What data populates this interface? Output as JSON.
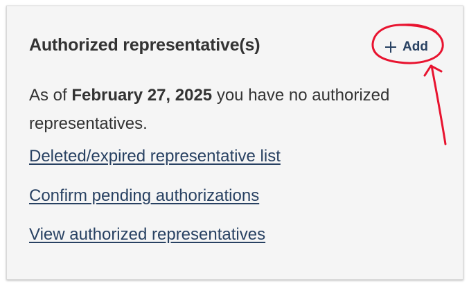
{
  "card": {
    "title": "Authorized representative(s)",
    "add_button": {
      "icon": "plus-icon",
      "label": "Add"
    },
    "status": {
      "prefix": "As of ",
      "date": "February 27, 2025",
      "suffix": " you have no authorized representatives."
    },
    "links": [
      "Deleted/expired representative list",
      "Confirm pending authorizations",
      "View authorized representatives"
    ]
  },
  "colors": {
    "card_background": "#f5f5f5",
    "text": "#333333",
    "link": "#284162",
    "annotation": "#e8132f"
  }
}
